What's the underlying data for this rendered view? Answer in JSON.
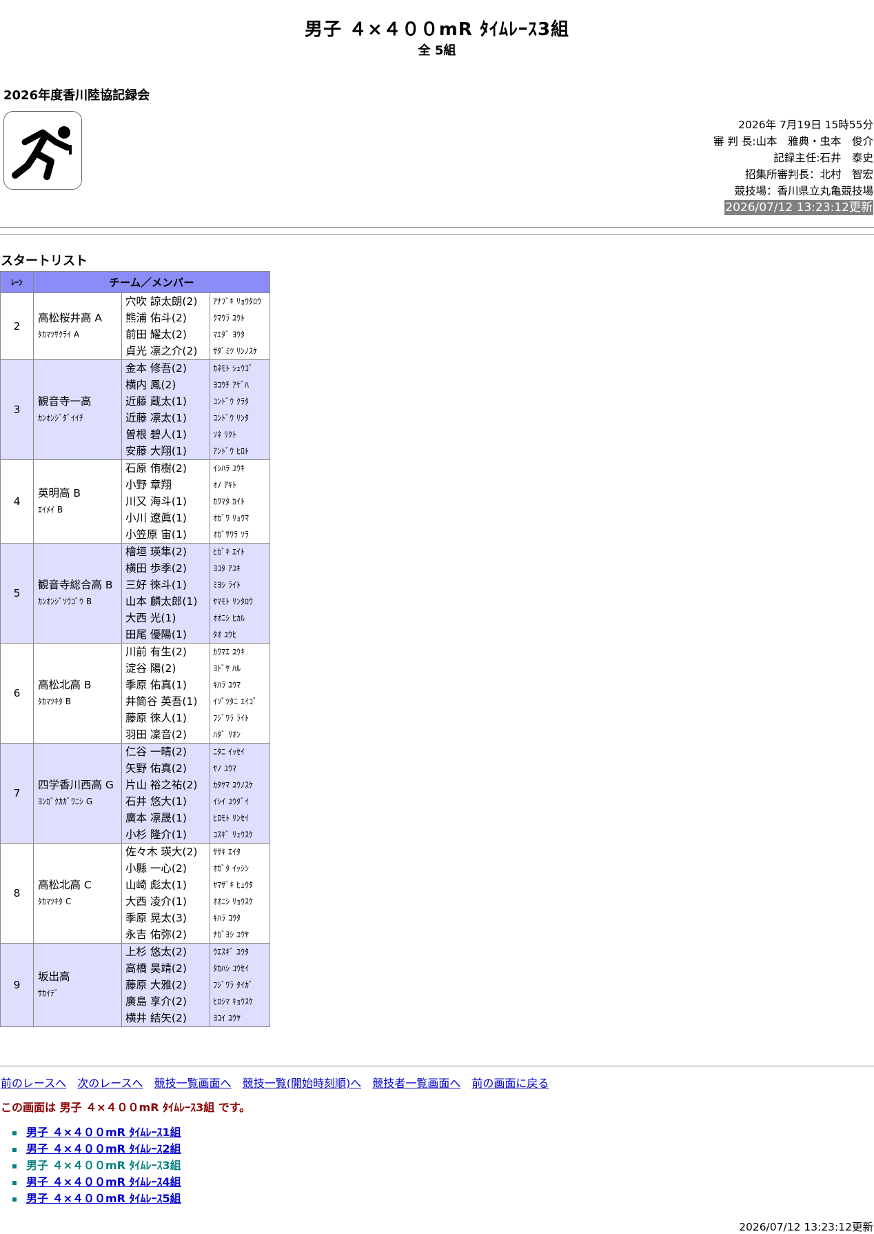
{
  "header": {
    "title": "男子 ４×４００mR ﾀｲﾑﾚｰｽ3組",
    "subtitle": "全 5組"
  },
  "meet_name": "2026年度香川陸協記録会",
  "logo_icon": "runner-icon",
  "info": {
    "datetime": "2026年 7月19日 15時55分",
    "referee": "審 判 長:山本　雅典・虫本　俊介",
    "recorder": "記録主任:石井　泰史",
    "call_referee": "招集所審判長：北村　智宏",
    "venue": "競技場：香川県立丸亀競技場",
    "updated": "2026/07/12 13:23:12更新"
  },
  "startlist": {
    "heading": "スタートリスト",
    "col_lane": "ﾚｰﾝ",
    "col_team": "チーム／メンバー",
    "rows": [
      {
        "lane": "2",
        "team": "高松桜井高 A",
        "team_kana": "ﾀｶﾏﾂｻｸﾗｲ A",
        "members": [
          "穴吹 諒太朗(2)",
          "熊浦 佑斗(2)",
          "前田 耀太(2)",
          "貞光 凛之介(2)"
        ],
        "members_kana": [
          "ｱﾅﾌﾞｷ ﾘｮｳﾀﾛｳ",
          "ｸﾏｳﾗ ﾕｳﾄ",
          "ﾏｴﾀﾞ ﾖｳﾀ",
          "ｻﾀﾞﾐﾂ ﾘﾝﾉｽｹ"
        ]
      },
      {
        "lane": "3",
        "team": "観音寺一高",
        "team_kana": "ｶﾝｵﾝｼﾞﾀﾞｲｲﾁ",
        "members": [
          "金本 修吾(2)",
          "横内 鳳(2)",
          "近藤 蔵太(1)",
          "近藤 凛太(1)",
          "曽根 碧人(1)",
          "安藤 大翔(1)"
        ],
        "members_kana": [
          "ｶﾈﾓﾄ ｼｭｳｺﾞ",
          "ﾖｺｳﾁ ｱｹﾞﾊ",
          "ｺﾝﾄﾞｳ ｸﾗﾀ",
          "ｺﾝﾄﾞｳ ﾘﾝﾀ",
          "ｿﾈ ﾘｸﾄ",
          "ｱﾝﾄﾞｳ ﾋﾛﾄ"
        ]
      },
      {
        "lane": "4",
        "team": "英明高 B",
        "team_kana": "ｴｲﾒｲ B",
        "members": [
          "石原 侑樹(2)",
          "小野 章翔",
          "川又 海斗(1)",
          "小川 遼眞(1)",
          "小笠原 宙(1)"
        ],
        "members_kana": [
          "ｲｼﾊﾗ ﾕｳｷ",
          "ｵﾉ ｱｷﾄ",
          "ｶﾜﾏﾀ ｶｲﾄ",
          "ｵｶﾞﾜ ﾘｮｳﾏ",
          "ｵｶﾞｻﾜﾗ ｿﾗ"
        ]
      },
      {
        "lane": "5",
        "team": "観音寺総合高 B",
        "team_kana": "ｶﾝｵﾝｼﾞｿｳｺﾞｳ B",
        "members": [
          "檜垣 瑛隼(2)",
          "横田 歩季(2)",
          "三好 徠斗(1)",
          "山本 麟太郎(1)",
          "大西 光(1)",
          "田尾 優陽(1)"
        ],
        "members_kana": [
          "ﾋｶﾞｷ ｴｲﾄ",
          "ﾖｺﾀ ｱﾕｷ",
          "ﾐﾖｼ ﾗｲﾄ",
          "ﾔﾏﾓﾄ ﾘﾝﾀﾛｳ",
          "ｵｵﾆｼ ﾋｶﾙ",
          "ﾀｵ ﾕｳﾋ"
        ]
      },
      {
        "lane": "6",
        "team": "高松北高 B",
        "team_kana": "ﾀｶﾏﾂｷﾀ B",
        "members": [
          "川前 有生(2)",
          "淀谷 陽(2)",
          "季原 佑真(1)",
          "井筒谷 英吾(1)",
          "藤原 徠人(1)",
          "羽田 凜音(2)"
        ],
        "members_kana": [
          "ｶﾜﾏｴ ﾕｳｷ",
          "ﾖﾄﾞﾔ ﾊﾙ",
          "ｷﾊﾗ ﾕｳﾏ",
          "ｲｿﾞﾂﾀﾆ ｴｲｺﾞ",
          "ﾌｼﾞﾜﾗ ﾗｲﾄ",
          "ﾊﾀﾞ ﾘｵﾝ"
        ]
      },
      {
        "lane": "7",
        "team": "四学香川西高 G",
        "team_kana": "ﾖﾝｶﾞｸｶｶﾞﾜﾆｼ G",
        "members": [
          "仁谷 一晴(2)",
          "矢野 佑真(2)",
          "片山 裕之祐(2)",
          "石井 悠大(1)",
          "廣本 凛晟(1)",
          "小杉 隆介(1)"
        ],
        "members_kana": [
          "ﾆﾀﾆ ｲｯｾｲ",
          "ﾔﾉ ﾕｳﾏ",
          "ｶﾀﾔﾏ ﾕｳﾉｽｹ",
          "ｲｼｲ ﾕｳﾀﾞｲ",
          "ﾋﾛﾓﾄ ﾘﾝｾｲ",
          "ｺｽｷﾞ ﾘｭｳｽｹ"
        ]
      },
      {
        "lane": "8",
        "team": "高松北高 C",
        "team_kana": "ﾀｶﾏﾂｷﾀ C",
        "members": [
          "佐々木 瑛大(2)",
          "小縣 一心(2)",
          "山崎 彪太(1)",
          "大西 凌介(1)",
          "季原 晃太(3)",
          "永吉 佑弥(2)"
        ],
        "members_kana": [
          "ｻｻｷ ｴｲﾀ",
          "ｵｶﾞﾀ ｲｯｼﾝ",
          "ﾔﾏｻﾞｷ ﾋｭｳﾀ",
          "ｵｵﾆｼ ﾘｮｳｽｹ",
          "ｷﾊﾗ ｺｳﾀ",
          "ﾅｶﾞﾖｼ ﾕｳﾔ"
        ]
      },
      {
        "lane": "9",
        "team": "坂出高",
        "team_kana": "ｻｶｲﾃﾞ",
        "members": [
          "上杉 悠太(2)",
          "高橋 昊靖(2)",
          "藤原 大雅(2)",
          "廣島 享介(2)",
          "横井 結矢(2)"
        ],
        "members_kana": [
          "ｳｴｽｷﾞ ﾕｳﾀ",
          "ﾀｶﾊｼ ｺｳｾｲ",
          "ﾌｼﾞﾜﾗ ﾀｲｶﾞ",
          "ﾋﾛｼﾏ ｷｮｳｽｹ",
          "ﾖｺｲ ﾕｳﾔ"
        ]
      }
    ]
  },
  "nav": {
    "links": [
      "前のレースへ",
      "次のレースへ",
      "競技一覧画面へ",
      "競技一覧(開始時刻順)へ",
      "競技者一覧画面へ",
      "前の画面に戻る"
    ]
  },
  "current_note": "この画面は 男子 ４×４００mR ﾀｲﾑﾚｰｽ3組 です。",
  "races": [
    {
      "label": "男子 ４×４００mR ﾀｲﾑﾚｰｽ1組",
      "current": false
    },
    {
      "label": "男子 ４×４００mR ﾀｲﾑﾚｰｽ2組",
      "current": false
    },
    {
      "label": "男子 ４×４００mR ﾀｲﾑﾚｰｽ3組",
      "current": true
    },
    {
      "label": "男子 ４×４００mR ﾀｲﾑﾚｰｽ4組",
      "current": false
    },
    {
      "label": "男子 ４×４００mR ﾀｲﾑﾚｰｽ5組",
      "current": false
    }
  ],
  "footer_updated": "2026/07/12 13:23:12更新"
}
